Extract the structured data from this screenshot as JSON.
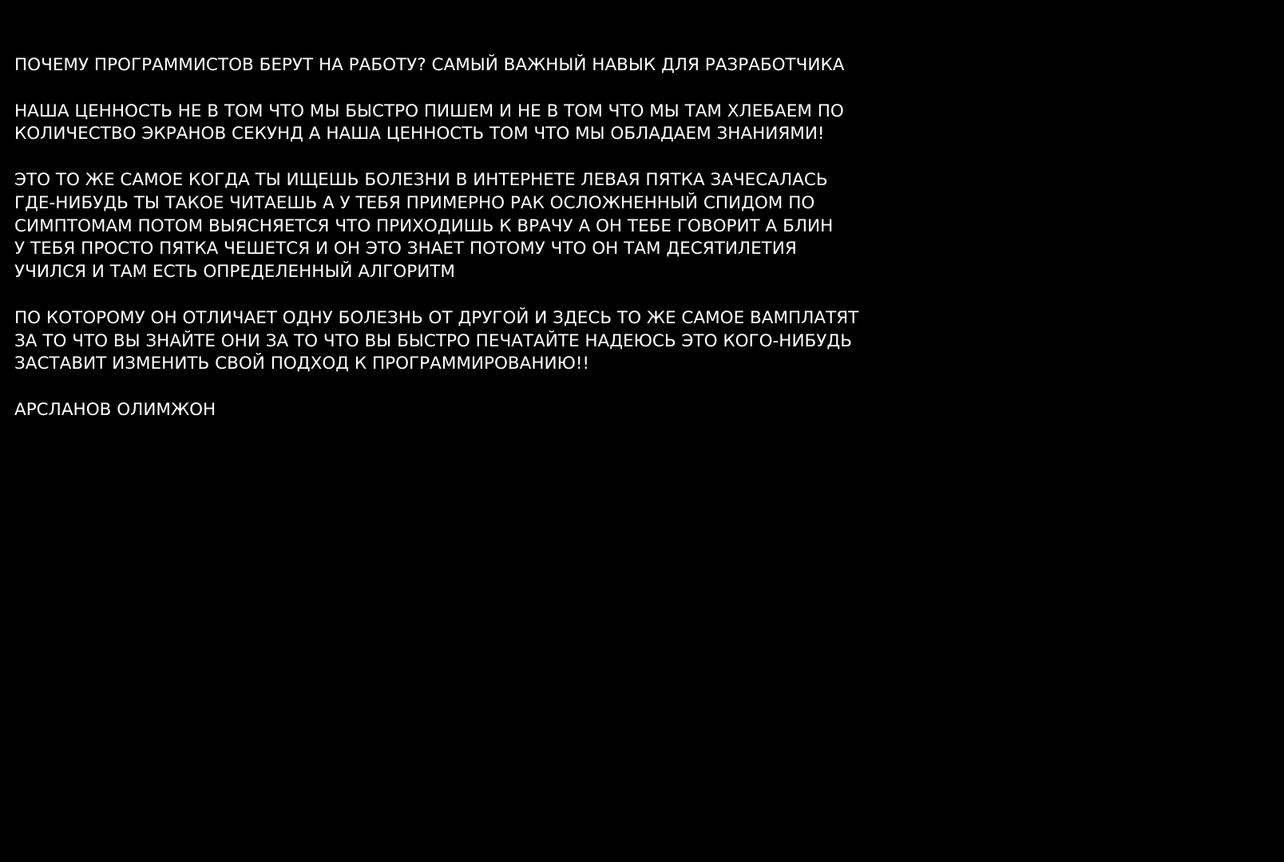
{
  "document": {
    "title": "ПОЧЕМУ ПРОГРАММИСТОВ БЕРУТ НА РАБОТУ? САМЫЙ ВАЖНЫЙ НАВЫК ДЛЯ РАЗРАБОТЧИКА",
    "paragraphs": [
      {
        "lines": [
          "НАША ЦЕННОСТЬ НЕ В ТОМ ЧТО МЫ БЫСТРО ПИШЕМ И НЕ В ТОМ ЧТО МЫ ТАМ ХЛЕБАЕМ ПО",
          "КОЛИЧЕСТВО ЭКРАНОВ СЕКУНД А НАША ЦЕННОСТЬ ТОМ ЧТО МЫ ОБЛАДАЕМ ЗНАНИЯМИ!"
        ]
      },
      {
        "lines": [
          "ЭТО ТО ЖЕ САМОЕ КОГДА ТЫ ИЩЕШЬ БОЛЕЗНИ В ИНТЕРНЕТЕ ЛЕВАЯ ПЯТКА ЗАЧЕСАЛАСЬ",
          "ГДЕ-НИБУДЬ ТЫ ТАКОЕ ЧИТАЕШЬ А У ТЕБЯ ПРИМЕРНО РАК ОСЛОЖНЕННЫЙ СПИДОМ ПО",
          "СИМПТОМАМ ПОТОМ ВЫЯСНЯЕТСЯ ЧТО ПРИХОДИШЬ К ВРАЧУ А ОН ТЕБЕ ГОВОРИТ А БЛИН",
          "У ТЕБЯ ПРОСТО ПЯТКА ЧЕШЕТСЯ И ОН ЭТО ЗНАЕТ ПОТОМУ ЧТО ОН ТАМ ДЕСЯТИЛЕТИЯ",
          "УЧИЛСЯ И ТАМ ЕСТЬ ОПРЕДЕЛЕННЫЙ АЛГОРИТМ"
        ]
      },
      {
        "lines": [
          "ПО КОТОРОМУ ОН ОТЛИЧАЕТ ОДНУ БОЛЕЗНЬ ОТ ДРУГОЙ И ЗДЕСЬ ТО ЖЕ САМОЕ ВАМПЛАТЯТ",
          "ЗА ТО ЧТО ВЫ ЗНАЙТЕ ОНИ ЗА ТО ЧТО ВЫ БЫСТРО ПЕЧАТАЙТЕ НАДЕЮСЬ ЭТО КОГО-НИБУДЬ",
          "ЗАСТАВИТ ИЗМЕНИТЬ СВОЙ ПОДХОД К ПРОГРАММИРОВАНИЮ!!"
        ]
      }
    ],
    "author": "АРСЛАНОВ ОЛИМЖОН"
  },
  "colors": {
    "background": "#000000",
    "text": "#ffffff"
  }
}
